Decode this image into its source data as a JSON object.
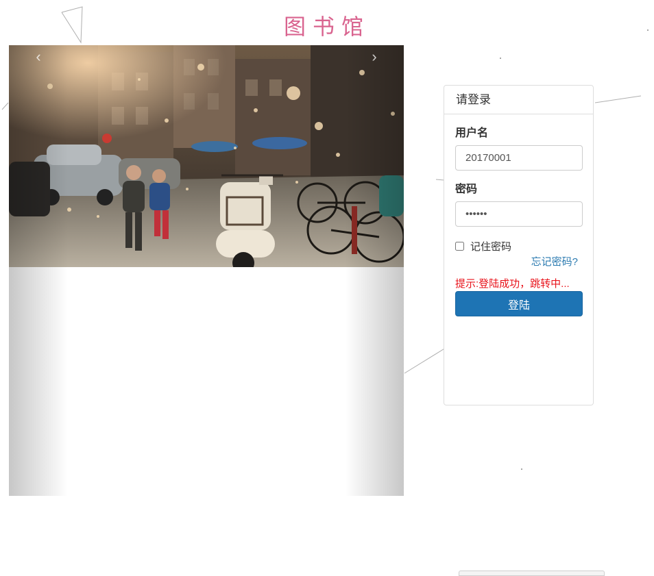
{
  "site": {
    "title": "图书馆"
  },
  "carousel": {
    "prev_icon": "‹",
    "next_icon": "›"
  },
  "login": {
    "heading": "请登录",
    "username_label": "用户名",
    "username_value": "20170001",
    "password_label": "密码",
    "password_value": "••••••",
    "remember_label": "记住密码",
    "remember_checked": false,
    "forgot_label": "忘记密码?",
    "status_message": "提示:登陆成功，跳转中...",
    "submit_label": "登陆"
  },
  "colors": {
    "title": "#d9648f",
    "primary_button": "#1e74b4",
    "link": "#2a7ab0",
    "status": "#e8121a"
  }
}
